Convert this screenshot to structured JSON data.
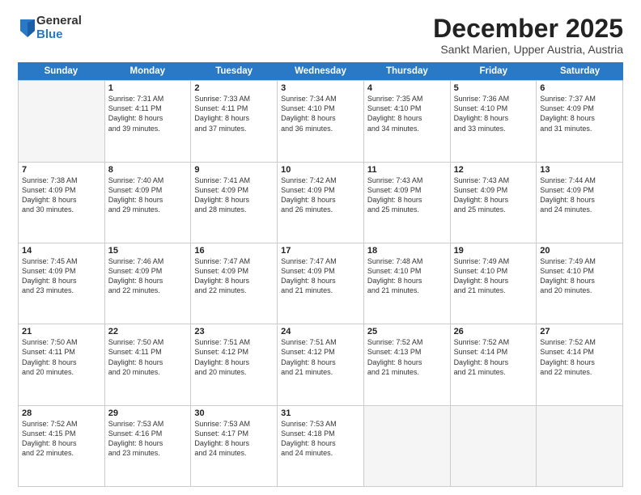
{
  "logo": {
    "general": "General",
    "blue": "Blue"
  },
  "title": {
    "month": "December 2025",
    "location": "Sankt Marien, Upper Austria, Austria"
  },
  "header": {
    "days": [
      "Sunday",
      "Monday",
      "Tuesday",
      "Wednesday",
      "Thursday",
      "Friday",
      "Saturday"
    ]
  },
  "weeks": [
    [
      {
        "day": "",
        "info": ""
      },
      {
        "day": "1",
        "info": "Sunrise: 7:31 AM\nSunset: 4:11 PM\nDaylight: 8 hours\nand 39 minutes."
      },
      {
        "day": "2",
        "info": "Sunrise: 7:33 AM\nSunset: 4:11 PM\nDaylight: 8 hours\nand 37 minutes."
      },
      {
        "day": "3",
        "info": "Sunrise: 7:34 AM\nSunset: 4:10 PM\nDaylight: 8 hours\nand 36 minutes."
      },
      {
        "day": "4",
        "info": "Sunrise: 7:35 AM\nSunset: 4:10 PM\nDaylight: 8 hours\nand 34 minutes."
      },
      {
        "day": "5",
        "info": "Sunrise: 7:36 AM\nSunset: 4:10 PM\nDaylight: 8 hours\nand 33 minutes."
      },
      {
        "day": "6",
        "info": "Sunrise: 7:37 AM\nSunset: 4:09 PM\nDaylight: 8 hours\nand 31 minutes."
      }
    ],
    [
      {
        "day": "7",
        "info": "Sunrise: 7:38 AM\nSunset: 4:09 PM\nDaylight: 8 hours\nand 30 minutes."
      },
      {
        "day": "8",
        "info": "Sunrise: 7:40 AM\nSunset: 4:09 PM\nDaylight: 8 hours\nand 29 minutes."
      },
      {
        "day": "9",
        "info": "Sunrise: 7:41 AM\nSunset: 4:09 PM\nDaylight: 8 hours\nand 28 minutes."
      },
      {
        "day": "10",
        "info": "Sunrise: 7:42 AM\nSunset: 4:09 PM\nDaylight: 8 hours\nand 26 minutes."
      },
      {
        "day": "11",
        "info": "Sunrise: 7:43 AM\nSunset: 4:09 PM\nDaylight: 8 hours\nand 25 minutes."
      },
      {
        "day": "12",
        "info": "Sunrise: 7:43 AM\nSunset: 4:09 PM\nDaylight: 8 hours\nand 25 minutes."
      },
      {
        "day": "13",
        "info": "Sunrise: 7:44 AM\nSunset: 4:09 PM\nDaylight: 8 hours\nand 24 minutes."
      }
    ],
    [
      {
        "day": "14",
        "info": "Sunrise: 7:45 AM\nSunset: 4:09 PM\nDaylight: 8 hours\nand 23 minutes."
      },
      {
        "day": "15",
        "info": "Sunrise: 7:46 AM\nSunset: 4:09 PM\nDaylight: 8 hours\nand 22 minutes."
      },
      {
        "day": "16",
        "info": "Sunrise: 7:47 AM\nSunset: 4:09 PM\nDaylight: 8 hours\nand 22 minutes."
      },
      {
        "day": "17",
        "info": "Sunrise: 7:47 AM\nSunset: 4:09 PM\nDaylight: 8 hours\nand 21 minutes."
      },
      {
        "day": "18",
        "info": "Sunrise: 7:48 AM\nSunset: 4:10 PM\nDaylight: 8 hours\nand 21 minutes."
      },
      {
        "day": "19",
        "info": "Sunrise: 7:49 AM\nSunset: 4:10 PM\nDaylight: 8 hours\nand 21 minutes."
      },
      {
        "day": "20",
        "info": "Sunrise: 7:49 AM\nSunset: 4:10 PM\nDaylight: 8 hours\nand 20 minutes."
      }
    ],
    [
      {
        "day": "21",
        "info": "Sunrise: 7:50 AM\nSunset: 4:11 PM\nDaylight: 8 hours\nand 20 minutes."
      },
      {
        "day": "22",
        "info": "Sunrise: 7:50 AM\nSunset: 4:11 PM\nDaylight: 8 hours\nand 20 minutes."
      },
      {
        "day": "23",
        "info": "Sunrise: 7:51 AM\nSunset: 4:12 PM\nDaylight: 8 hours\nand 20 minutes."
      },
      {
        "day": "24",
        "info": "Sunrise: 7:51 AM\nSunset: 4:12 PM\nDaylight: 8 hours\nand 21 minutes."
      },
      {
        "day": "25",
        "info": "Sunrise: 7:52 AM\nSunset: 4:13 PM\nDaylight: 8 hours\nand 21 minutes."
      },
      {
        "day": "26",
        "info": "Sunrise: 7:52 AM\nSunset: 4:14 PM\nDaylight: 8 hours\nand 21 minutes."
      },
      {
        "day": "27",
        "info": "Sunrise: 7:52 AM\nSunset: 4:14 PM\nDaylight: 8 hours\nand 22 minutes."
      }
    ],
    [
      {
        "day": "28",
        "info": "Sunrise: 7:52 AM\nSunset: 4:15 PM\nDaylight: 8 hours\nand 22 minutes."
      },
      {
        "day": "29",
        "info": "Sunrise: 7:53 AM\nSunset: 4:16 PM\nDaylight: 8 hours\nand 23 minutes."
      },
      {
        "day": "30",
        "info": "Sunrise: 7:53 AM\nSunset: 4:17 PM\nDaylight: 8 hours\nand 24 minutes."
      },
      {
        "day": "31",
        "info": "Sunrise: 7:53 AM\nSunset: 4:18 PM\nDaylight: 8 hours\nand 24 minutes."
      },
      {
        "day": "",
        "info": ""
      },
      {
        "day": "",
        "info": ""
      },
      {
        "day": "",
        "info": ""
      }
    ]
  ]
}
